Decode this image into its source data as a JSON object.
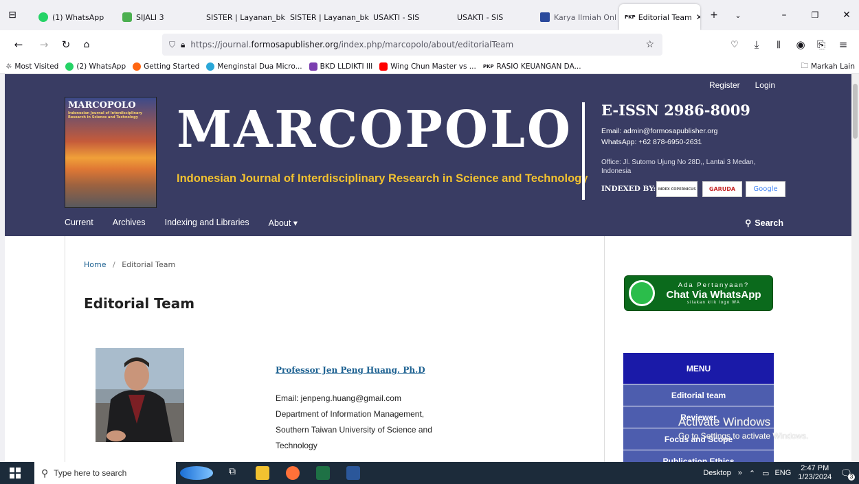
{
  "browser": {
    "tabs": [
      {
        "label": "(1) WhatsApp",
        "icon": "whatsapp-icon",
        "color": "#25d366"
      },
      {
        "label": "SIJALI 3",
        "icon": "app-icon",
        "color": "#4caf50"
      },
      {
        "label": "SISTER | Layanan_bkd",
        "icon": "",
        "color": ""
      },
      {
        "label": "SISTER | Layanan_bkd",
        "icon": "",
        "color": ""
      },
      {
        "label": "USAKTI - SIS",
        "icon": "",
        "color": ""
      },
      {
        "label": "USAKTI - SIS",
        "icon": "",
        "color": ""
      },
      {
        "label": "Karya Ilmiah Onl",
        "icon": "library-icon",
        "color": "#2b4a9c"
      },
      {
        "label": "Editorial Team",
        "icon": "pkp-icon",
        "color": "#333"
      }
    ],
    "url_prefix": "https://journal.",
    "url_domain": "formosapublisher.org",
    "url_path": "/index.php/marcopolo/about/editorialTeam",
    "bookmarks": [
      {
        "label": "Most Visited",
        "color": "#6b6b6b"
      },
      {
        "label": "(2) WhatsApp",
        "color": "#25d366"
      },
      {
        "label": "Getting Started",
        "color": "#ff6611"
      },
      {
        "label": "Menginstal Dua Micro...",
        "color": "#2aa7d8"
      },
      {
        "label": "BKD LLDIKTI III",
        "color": "#7b3fb0"
      },
      {
        "label": "Wing Chun Master vs ...",
        "color": "#ff0000"
      },
      {
        "label": "RASIO KEUANGAN DA...",
        "color": "#333333"
      }
    ],
    "other_bookmarks": "Markah Lain"
  },
  "site": {
    "register": "Register",
    "login": "Login",
    "cover_title": "MARCOPOLO",
    "cover_subtitle": "Indonesian Journal of Interdisciplinary Research in Science and Technology",
    "title": "MARCOPOLO",
    "subtitle": "Indonesian Journal of Interdisciplinary Research in Science and Technology",
    "issn": "E-ISSN 2986-8009",
    "email": "Email: admin@formosapublisher.org",
    "whatsapp": "WhatsApp: +62 878-6950-2631",
    "office": "Office: Jl. Sutomo Ujung No 28D,, Lantai 3 Medan, Indonesia",
    "indexed_by": "INDEXED BY:",
    "index_logos": [
      "INDEX COPERNICUS",
      "GARUDA",
      "Google"
    ],
    "nav": [
      "Current",
      "Archives",
      "Indexing and Libraries",
      "About ▾"
    ],
    "search": "Search"
  },
  "page": {
    "breadcrumb_home": "Home",
    "breadcrumb_sep": "/",
    "breadcrumb_current": "Editorial Team",
    "title": "Editorial Team",
    "member_name": "Professor Jen Peng Huang, Ph.D",
    "member_email": "Email: jenpeng.huang@gmail.com",
    "member_dept": "Department of Information Management,",
    "member_univ": "Southern Taiwan University of Science and",
    "member_univ2": "Technology"
  },
  "sidebar": {
    "wa_line1": "Ada Pertanyaan?",
    "wa_line2": "Chat Via WhatsApp",
    "wa_line3": "silakan klik logo WA",
    "menu_title": "MENU",
    "menu_items": [
      "Editorial team",
      "Reviewer",
      "Focus and Scope",
      "Publication Ethics"
    ]
  },
  "watermark": {
    "line1": "Activate Windows",
    "line2": "Go to Settings to activate Windows."
  },
  "taskbar": {
    "search_placeholder": "Type here to search",
    "desktop": "Desktop",
    "lang": "ENG",
    "time": "2:47 PM",
    "date": "1/23/2024",
    "notif_count": "3"
  }
}
